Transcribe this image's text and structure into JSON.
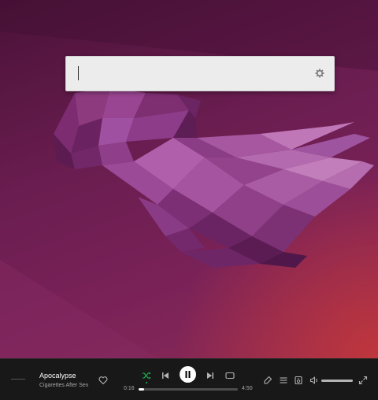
{
  "launcher": {
    "query": "",
    "settings_icon": "gear-icon"
  },
  "player": {
    "track": {
      "title": "Apocalypse",
      "artist": "Cigarettes After Sex"
    },
    "time": {
      "current": "0:16",
      "total": "4:50"
    },
    "progress_fraction": 0.055,
    "volume_fraction": 1.0,
    "shuffle_active": true,
    "is_playing": true,
    "icons": {
      "like": "heart-icon",
      "shuffle": "shuffle-icon",
      "previous": "skip-back-icon",
      "play_pause": "pause-icon",
      "next": "skip-forward-icon",
      "repeat": "repeat-icon",
      "lyrics": "microphone-icon",
      "queue": "queue-icon",
      "device": "connect-device-icon",
      "volume": "volume-icon",
      "fullscreen": "fullscreen-icon"
    },
    "colors": {
      "bar_background": "#181818",
      "accent": "#1db954"
    }
  }
}
